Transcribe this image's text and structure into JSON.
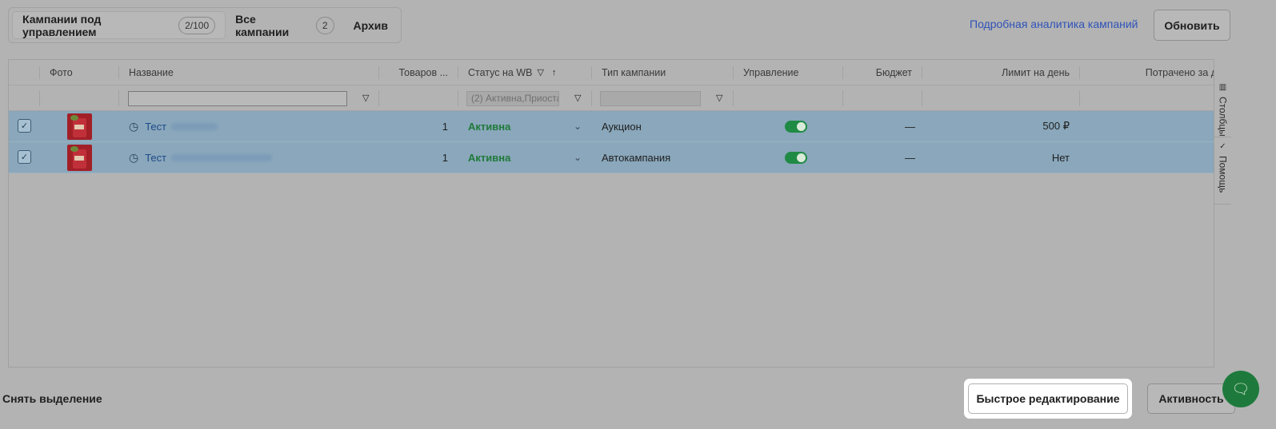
{
  "tabs": [
    {
      "label": "Кампании под управлением",
      "count": "2/100",
      "active": true
    },
    {
      "label": "Все кампании",
      "count": "2",
      "active": false
    },
    {
      "label": "Архив",
      "count": null,
      "active": false
    }
  ],
  "header_actions": {
    "analytics_link": "Подробная аналитика кампаний",
    "refresh_label": "Обновить"
  },
  "table": {
    "columns": {
      "photo": "Фото",
      "name": "Название",
      "goods": "Товаров ...",
      "status": "Статус на WB",
      "type": "Тип кампании",
      "control": "Управление",
      "budget": "Бюджет",
      "daily_limit": "Лимит на день",
      "spent": "Потрачено за де"
    },
    "filters": {
      "status_value": "(2) Активна,Приоста"
    },
    "rows": [
      {
        "selected": true,
        "name_prefix": "Тест",
        "goods": "1",
        "status": "Активна",
        "type": "Аукцион",
        "control_on": true,
        "budget": "—",
        "daily_limit": "500 ₽"
      },
      {
        "selected": true,
        "name_prefix": "Тест",
        "goods": "1",
        "status": "Активна",
        "type": "Автокампания",
        "control_on": true,
        "budget": "—",
        "daily_limit": "Нет"
      }
    ]
  },
  "side_panel": {
    "columns_label": "Столбцы",
    "help_label": "Помощь"
  },
  "bottom": {
    "deselect_label": "Снять выделение",
    "quick_edit_label": "Быстрое редактирование",
    "activity_label": "Активность"
  },
  "icons": {
    "filter": "filter-icon",
    "sort_asc": "arrow-up-icon",
    "clock": "clock-icon",
    "chevron": "chevron-down-icon",
    "chat": "chat-icon"
  },
  "colors": {
    "selected_row": "#8aa7bb",
    "active_status": "#1f7a3a",
    "toggle_on": "#1f8a44",
    "link": "#2f53b8"
  }
}
